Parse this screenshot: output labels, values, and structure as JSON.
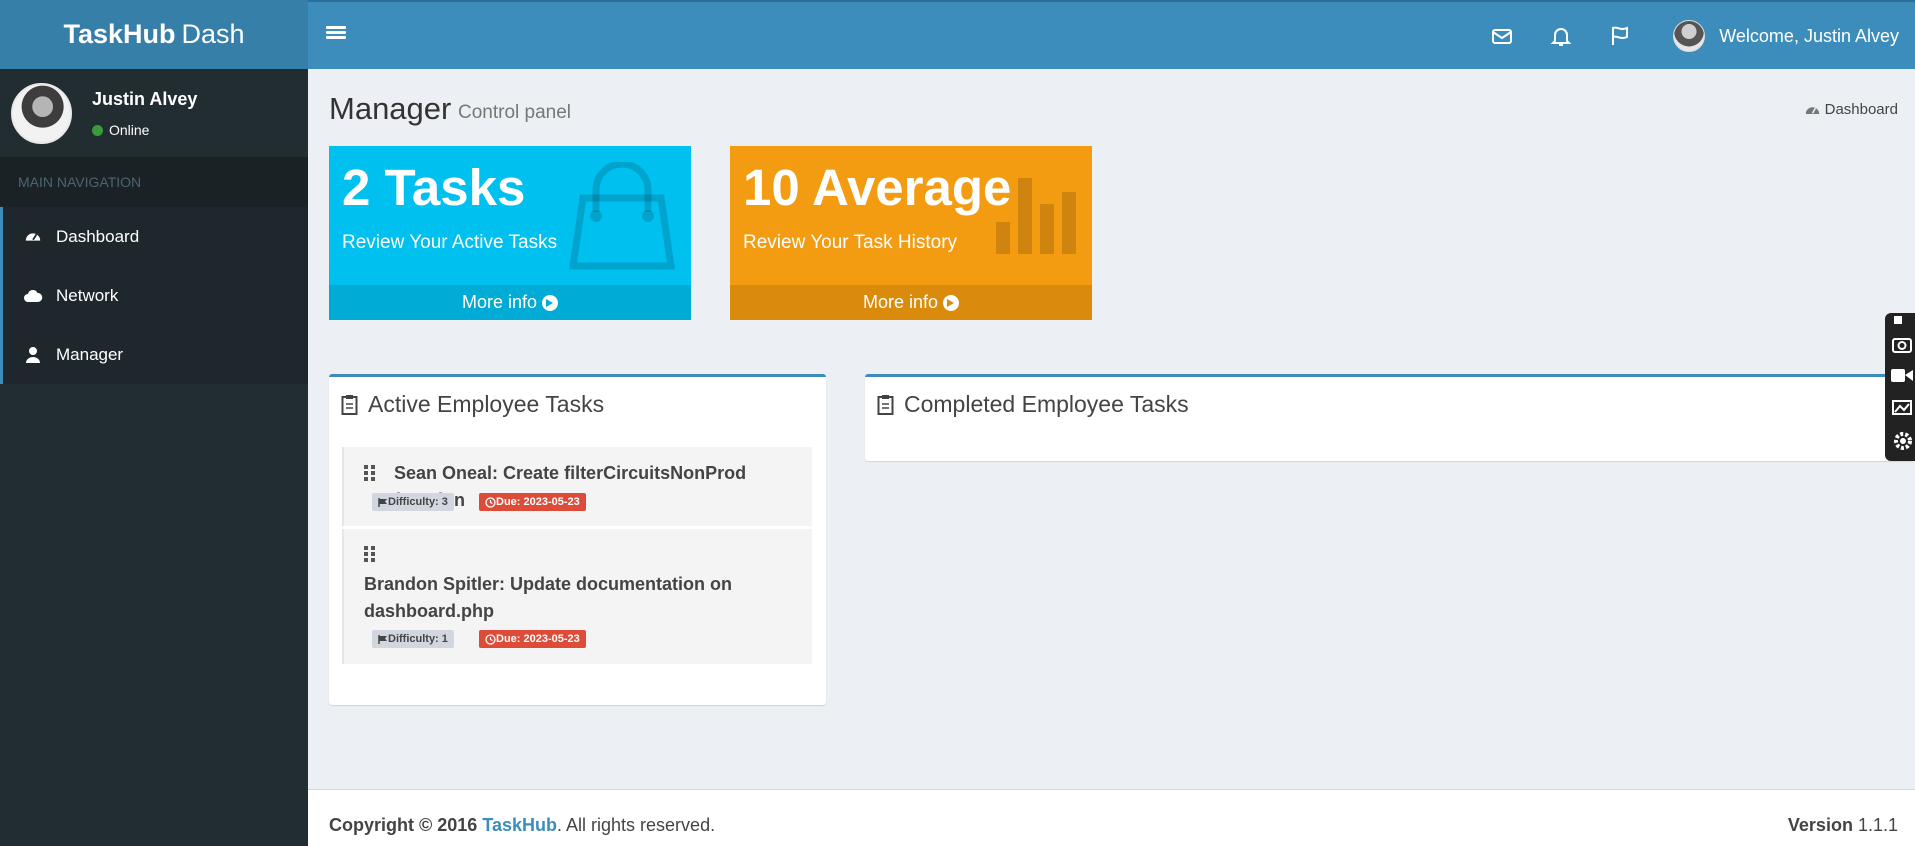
{
  "app": {
    "logo_bold": "TaskHub",
    "logo_light": "Dash"
  },
  "header": {
    "welcome": "Welcome, Justin Alvey"
  },
  "user": {
    "name": "Justin Alvey",
    "status": "Online"
  },
  "sidebar": {
    "header": "MAIN NAVIGATION",
    "items": [
      {
        "label": "Dashboard",
        "icon": "dashboard-icon"
      },
      {
        "label": "Network",
        "icon": "cloud-icon"
      },
      {
        "label": "Manager",
        "icon": "user-icon"
      }
    ]
  },
  "page": {
    "title": "Manager",
    "subtitle": "Control panel",
    "breadcrumb": "Dashboard"
  },
  "stats": [
    {
      "value": "2 Tasks",
      "text": "Review Your Active Tasks",
      "link": "More info",
      "color": "#00c0ef",
      "icon": "shopping-bag-icon"
    },
    {
      "value": "10 Average",
      "text": "Review Your Task History",
      "link": "More info",
      "color": "#f39c12",
      "icon": "bar-chart-icon"
    }
  ],
  "active_box": {
    "title": "Active Employee Tasks",
    "tasks": [
      {
        "text": "Sean Oneal: Create filterCircuitsNonProd function",
        "difficulty": "Difficulty: 3",
        "due": "Due: 2023-05-23"
      },
      {
        "text_line1": "Brandon Spitler: Update documentation on",
        "text_line2": "dashboard.php",
        "difficulty": "Difficulty: 1",
        "due": "Due: 2023-05-23"
      }
    ]
  },
  "completed_box": {
    "title": "Completed Employee Tasks"
  },
  "footer": {
    "copyright": "Copyright © 2016",
    "brand": "TaskHub",
    "rights": ". All rights reserved.",
    "version_label": "Version",
    "version": "1.1.1"
  }
}
